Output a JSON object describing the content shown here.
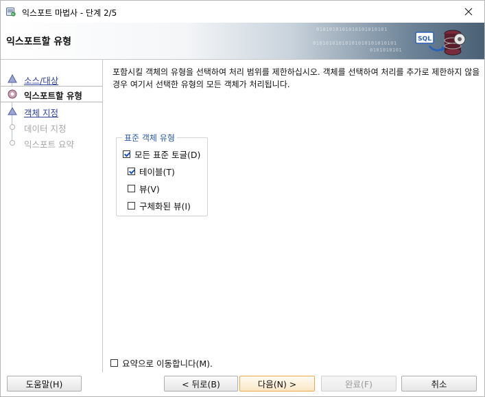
{
  "window": {
    "title": "익스포트 마법사 - 단계 2/5",
    "close_glyph": "✕"
  },
  "banner": {
    "title": "익스포트할 유형",
    "binary_lines": [
      "0101010101010101010101",
      "01010101010101010101010101",
      "0101010101"
    ],
    "sql_label": "SQL"
  },
  "nav": {
    "items": [
      {
        "label": "소스/대상",
        "state": "link"
      },
      {
        "label": "익스포트할 유형",
        "state": "current"
      },
      {
        "label": "객체 지정",
        "state": "link"
      },
      {
        "label": "데이터 지정",
        "state": "disabled"
      },
      {
        "label": "익스포트 요약",
        "state": "disabled"
      }
    ]
  },
  "main": {
    "description": "포함시킬 객체의 유형을 선택하여 처리 범위를 제한하십시오. 객체를 선택하여 처리를 추가로 제한하지 않을 경우 여기서 선택한 유형의 모든 객체가 처리됩니다.",
    "group_title": "표준 객체 유형",
    "options": [
      {
        "label": "모든 표준 토글(D)",
        "checked": true
      },
      {
        "label": "테이블(T)",
        "checked": true
      },
      {
        "label": "뷰(V)",
        "checked": false
      },
      {
        "label": "구체화된 뷰(I)",
        "checked": false
      }
    ]
  },
  "summary_checkbox": {
    "label": "요약으로 이동합니다(M).",
    "checked": false
  },
  "buttons": {
    "help": "도움말(H)",
    "back": "< 뒤로(B)",
    "next": "다음(N) >",
    "finish": "완료(F)",
    "cancel": "취소"
  },
  "colors": {
    "link": "#2b3f9c",
    "group_title": "#2a5aa6",
    "default_button_border": "#f0a94a"
  }
}
